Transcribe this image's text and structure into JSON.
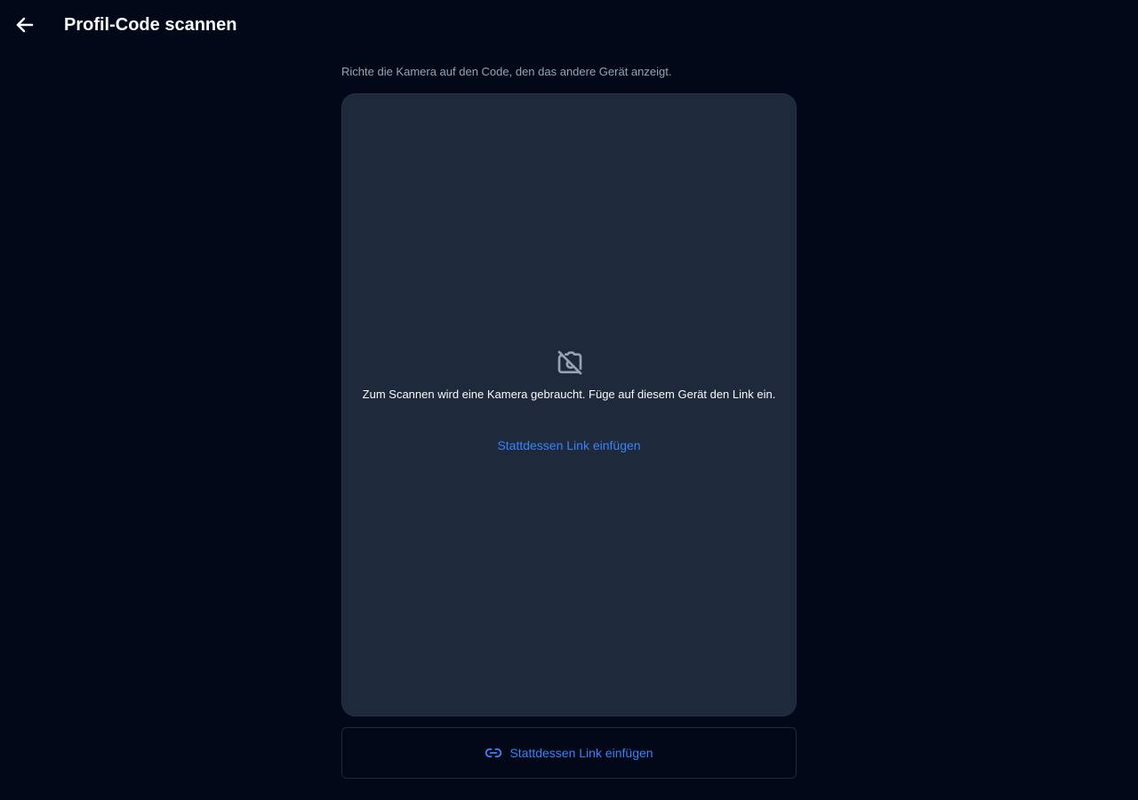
{
  "header": {
    "title": "Profil-Code scannen",
    "back_icon": "arrow-left-icon"
  },
  "instruction": "Richte die Kamera auf den Code, den das andere Gerät anzeigt.",
  "camera_panel": {
    "icon": "camera-off-icon",
    "message": "Zum Scannen wird eine Kamera gebraucht. Füge auf diesem Gerät den Link ein.",
    "link_label": "Stattdessen Link einfügen"
  },
  "paste_button": {
    "icon": "link-icon",
    "label": "Stattdessen Link einfügen"
  },
  "colors": {
    "background": "#020817",
    "panel": "#1e293b",
    "accent": "#3b82f6",
    "muted_text": "#94a3b8",
    "text": "#f8fafc"
  }
}
